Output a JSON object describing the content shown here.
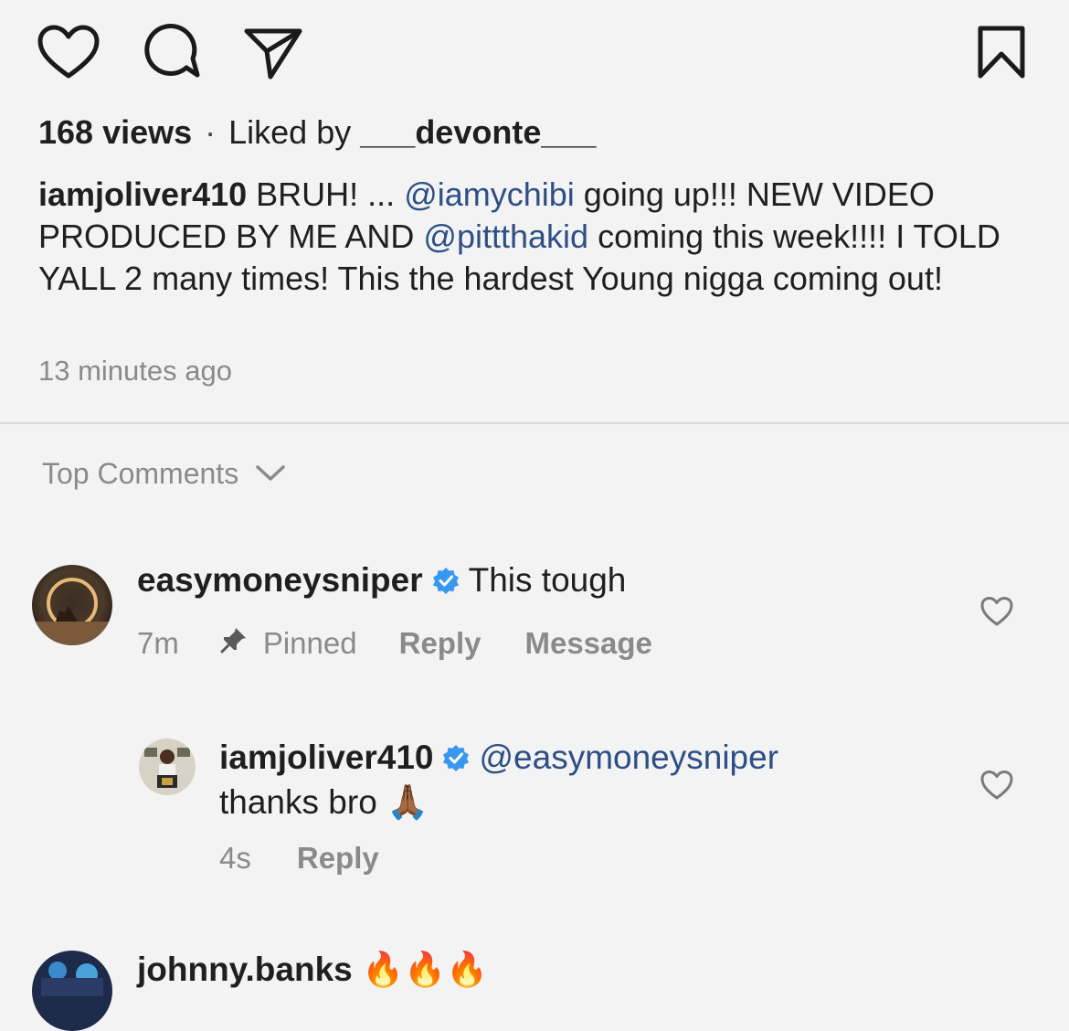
{
  "actions": {
    "like_icon": "heart-outline",
    "comment_icon": "speech-bubble",
    "share_icon": "paper-plane",
    "save_icon": "bookmark-outline"
  },
  "stats": {
    "views": "168 views",
    "separator": "·",
    "liked_by_prefix": "Liked by",
    "liked_by_user": "___devonte___"
  },
  "caption": {
    "username": "iamjoliver410",
    "text_1": " BRUH! ... ",
    "mention_1": "@iamychibi",
    "text_2": " going up!!! NEW VIDEO PRODUCED BY ME AND ",
    "mention_2": "@pittthakid",
    "text_3": " coming this week!!!! I TOLD YALL 2 many times! This the hardest Young nigga coming out!"
  },
  "time_ago": "13 minutes ago",
  "comments_header": {
    "label": "Top Comments"
  },
  "comments": [
    {
      "username": "easymoneysniper",
      "text": "This tough",
      "time": "7m",
      "pinned_label": "Pinned",
      "reply_label": "Reply",
      "message_label": "Message"
    },
    {
      "username": "iamjoliver410",
      "mention": "@easymoneysniper",
      "text": "thanks bro ",
      "emoji": "🙏🏾",
      "time": "4s",
      "reply_label": "Reply"
    },
    {
      "username": "johnny.banks",
      "emoji": "🔥🔥🔥"
    }
  ],
  "colors": {
    "background": "#f3f3f3",
    "text": "#1f1f1f",
    "mention": "#2d4f85",
    "muted": "#8a8a8a",
    "verified": "#3897f0"
  }
}
